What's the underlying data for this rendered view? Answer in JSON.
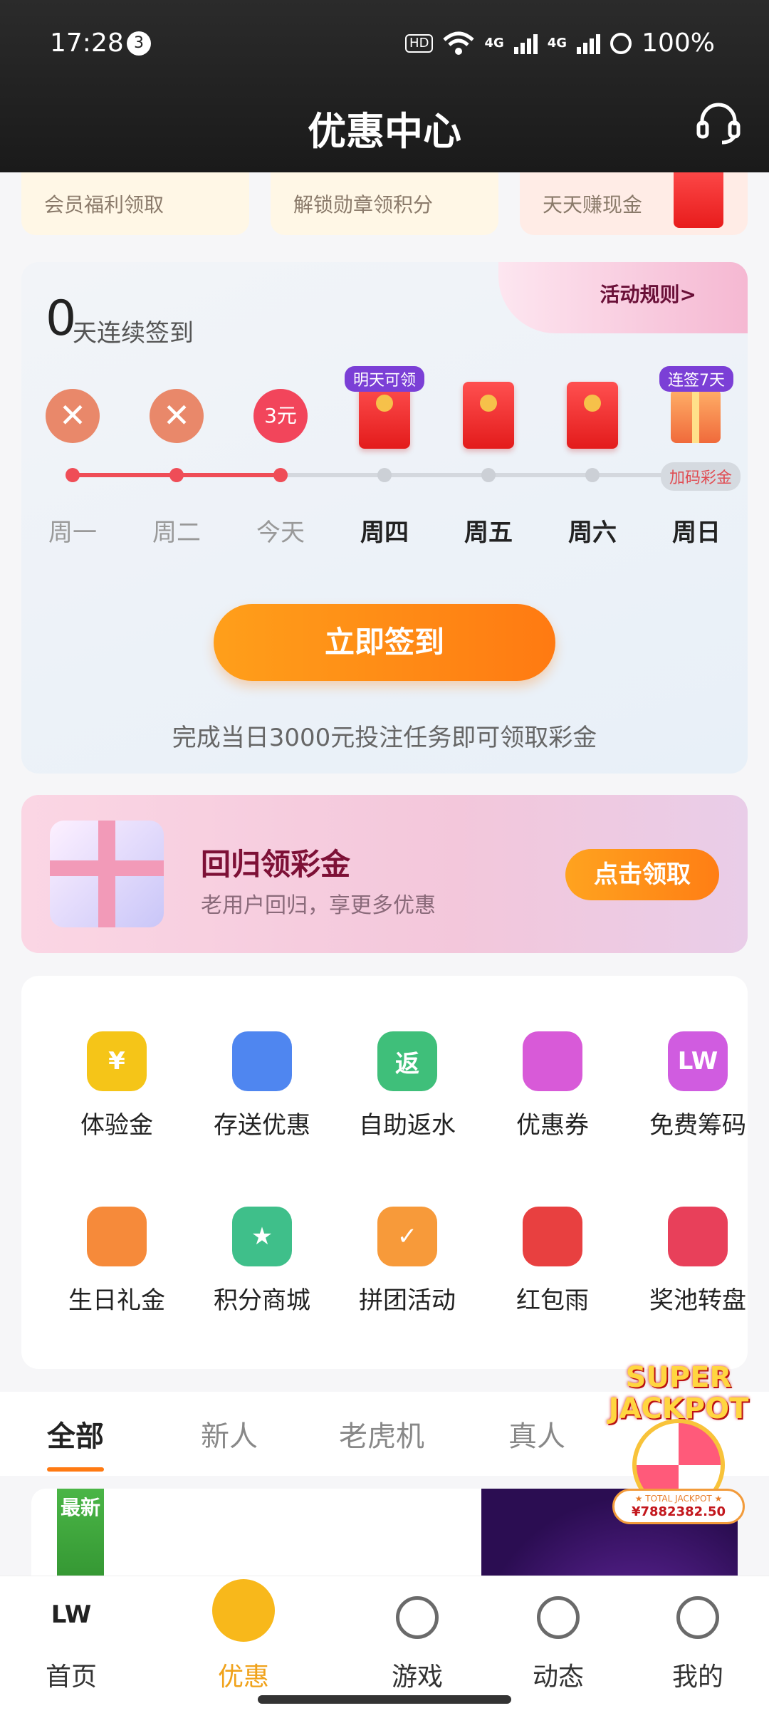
{
  "status": {
    "time": "17:28",
    "notifications": "3",
    "hd": "HD",
    "net1": "4G",
    "net2": "4G",
    "battery": "100%"
  },
  "header": {
    "title": "优惠中心"
  },
  "top_cards": [
    {
      "subtitle": "会员福利领取"
    },
    {
      "subtitle": "解锁勋章领积分"
    },
    {
      "subtitle": "天天赚现金"
    }
  ],
  "checkin": {
    "rules": "活动规则>",
    "days_count": "0",
    "days_label": "天连续签到",
    "today_reward": "3元",
    "badge_tomorrow": "明天可领",
    "badge_7days": "连签7天",
    "bonus_label": "加码彩金",
    "days": [
      "周一",
      "周二",
      "今天",
      "周四",
      "周五",
      "周六",
      "周日"
    ],
    "sign_button": "立即签到",
    "tip": "完成当日3000元投注任务即可领取彩金"
  },
  "return_banner": {
    "title": "回归领彩金",
    "subtitle": "老用户回归，享更多优惠",
    "button": "点击领取"
  },
  "grid": [
    {
      "label": "体验金",
      "icon": "coin-icon",
      "glyph": "¥",
      "color": "#f5c518"
    },
    {
      "label": "存送优惠",
      "icon": "wallet-icon",
      "glyph": "",
      "color": "#4f86f0"
    },
    {
      "label": "自助返水",
      "icon": "rebate-drop-icon",
      "glyph": "返",
      "color": "#3fbf7a"
    },
    {
      "label": "优惠券",
      "icon": "coupon-icon",
      "glyph": "",
      "color": "#d85ad8"
    },
    {
      "label": "免费筹码",
      "icon": "chip-icon",
      "glyph": "LW",
      "color": "#d05ce0"
    },
    {
      "label": "生日礼金",
      "icon": "cake-icon",
      "glyph": "",
      "color": "#f68a3a"
    },
    {
      "label": "积分商城",
      "icon": "store-icon",
      "glyph": "★",
      "color": "#3fbf8a"
    },
    {
      "label": "拼团活动",
      "icon": "group-buy-icon",
      "glyph": "✓",
      "color": "#f79a3a"
    },
    {
      "label": "红包雨",
      "icon": "red-envelope-icon",
      "glyph": "",
      "color": "#e84040"
    },
    {
      "label": "奖池转盘",
      "icon": "prize-wheel-icon",
      "glyph": "",
      "color": "#e8405a"
    }
  ],
  "tabs": [
    "全部",
    "新人",
    "老虎机",
    "真人"
  ],
  "jackpot": {
    "line1": "SUPER",
    "line2": "JACKPOT",
    "label": "★ TOTAL JACKPOT ★",
    "amount": "¥7882382.50"
  },
  "promo": {
    "ribbon": "最新"
  },
  "bottom_nav": [
    {
      "label": "首页",
      "logo": "LW"
    },
    {
      "label": "优惠"
    },
    {
      "label": "游戏"
    },
    {
      "label": "动态"
    },
    {
      "label": "我的"
    }
  ]
}
